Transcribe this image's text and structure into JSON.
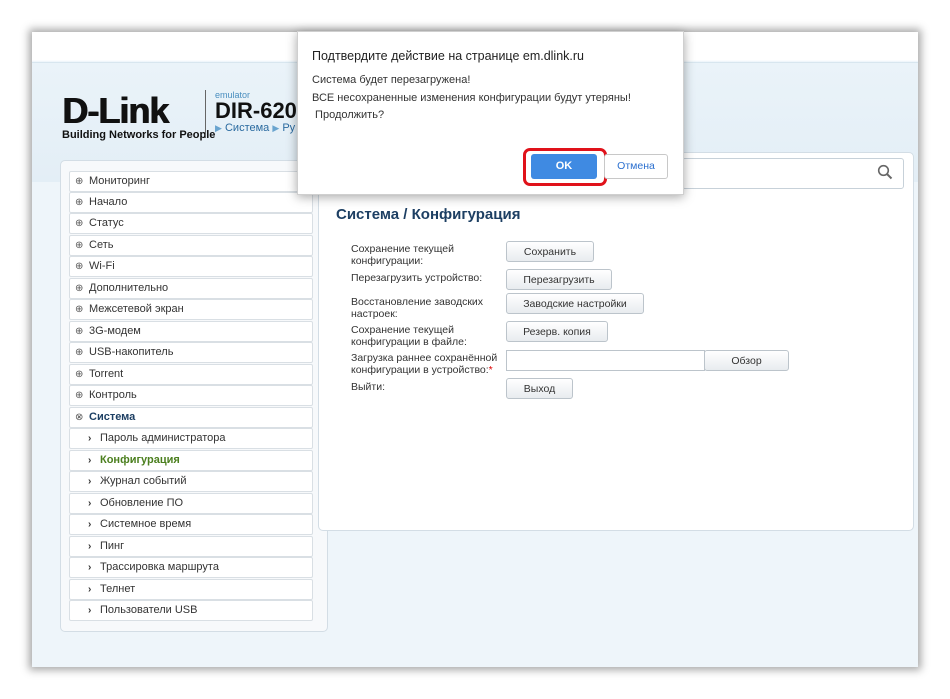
{
  "header": {
    "logo_main": "D-Link",
    "logo_sub": "Building Networks for People",
    "model_emulator": "emulator",
    "model_name": "DIR-620",
    "breadcrumb_1": "Система",
    "breadcrumb_2": "Ру"
  },
  "search": {
    "placeholder": ""
  },
  "sidebar": {
    "items": [
      {
        "label": "Мониторинг"
      },
      {
        "label": "Начало"
      },
      {
        "label": "Статус"
      },
      {
        "label": "Сеть"
      },
      {
        "label": "Wi-Fi"
      },
      {
        "label": "Дополнительно"
      },
      {
        "label": "Межсетевой экран"
      },
      {
        "label": "3G-модем"
      },
      {
        "label": "USB-накопитель"
      },
      {
        "label": "Torrent"
      },
      {
        "label": "Контроль"
      },
      {
        "label": "Система"
      }
    ],
    "subitems": [
      {
        "label": "Пароль администратора"
      },
      {
        "label": "Конфигурация"
      },
      {
        "label": "Журнал событий"
      },
      {
        "label": "Обновление ПО"
      },
      {
        "label": "Системное время"
      },
      {
        "label": "Пинг"
      },
      {
        "label": "Трассировка маршрута"
      },
      {
        "label": "Телнет"
      },
      {
        "label": "Пользователи USB"
      }
    ]
  },
  "main": {
    "title": "Система /  Конфигурация",
    "rows": [
      {
        "label": "Сохранение текущей конфигурации:",
        "button": "Сохранить"
      },
      {
        "label": "Перезагрузить устройство:",
        "button": "Перезагрузить"
      },
      {
        "label": "Восстановление заводских настроек:",
        "button": "Заводские настройки"
      },
      {
        "label": "Сохранение текущей конфигурации в файле:",
        "button": "Резерв. копия"
      },
      {
        "label": "Загрузка раннее сохранённой конфигурации в устройство:",
        "required": "*",
        "button": "Обзор"
      },
      {
        "label": "Выйти:",
        "button": "Выход"
      }
    ]
  },
  "dialog": {
    "title": "Подтвердите действие на странице em.dlink.ru",
    "line1": "Система будет перезагружена!",
    "line2": "ВСЕ несохраненные изменения конфигурации будут утеряны!",
    "line3": " Продолжить?",
    "ok_label": "OK",
    "cancel_label": "Отмена",
    "highlight_color": "#e0121a",
    "ok_color": "#3f8ae2"
  }
}
